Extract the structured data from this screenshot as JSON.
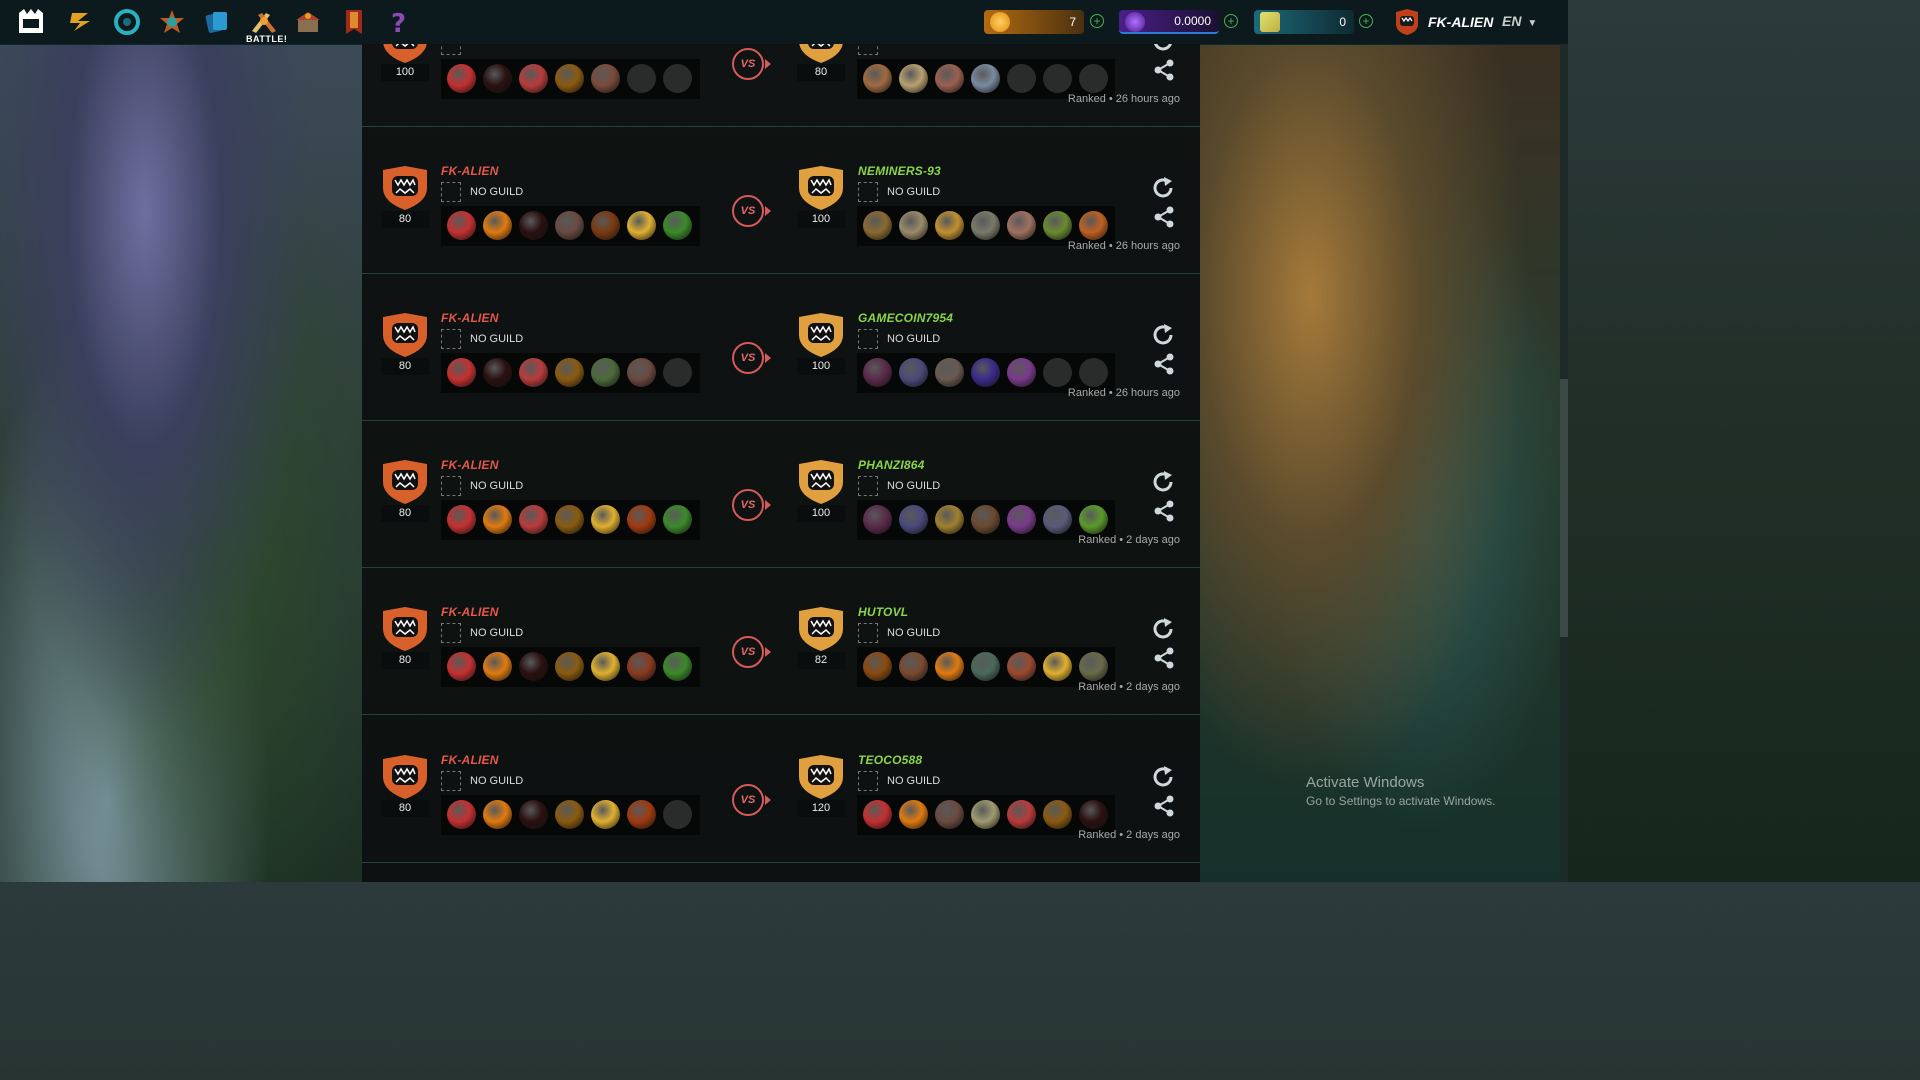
{
  "topnav": {
    "battle_label": "BATTLE!",
    "icons": [
      "logo-icon",
      "quest-icon",
      "portal-icon",
      "leaderboard-icon",
      "cards-icon",
      "battle-icon",
      "shop-icon",
      "guild-icon",
      "help-icon"
    ]
  },
  "currencies": [
    {
      "name": "dec",
      "value": "7"
    },
    {
      "name": "sps",
      "value": "0.0000"
    },
    {
      "name": "credits",
      "value": "0"
    }
  ],
  "user": {
    "name": "FK-ALIEN",
    "language": "EN"
  },
  "windows_notice": {
    "title": "Activate Windows",
    "subtitle": "Go to Settings to activate Windows."
  },
  "colors": {
    "panel": "#0d1010",
    "name_left": "#e5584a",
    "name_right": "#8bd44a",
    "accent": "#d55a5a"
  },
  "battles": [
    {
      "left": {
        "rating": "100",
        "name": "",
        "guild": "",
        "cards": [
          "#c53030",
          "#2a1010",
          "#b83b3b",
          "#8a5a10",
          "#7a4a3a",
          "empty",
          "empty"
        ]
      },
      "right": {
        "rating": "80",
        "name": "",
        "guild": "",
        "cards": [
          "#a06a40",
          "#b8a070",
          "#9a6050",
          "#7a8aa0",
          "empty",
          "empty",
          "empty"
        ]
      },
      "vs": "VS",
      "meta": "Ranked • 26 hours ago"
    },
    {
      "left": {
        "rating": "80",
        "name": "FK-ALIEN",
        "guild": "NO GUILD",
        "cards": [
          "#c53030",
          "#e07a10",
          "#2a1010",
          "#6a4a40",
          "#7a3a10",
          "#e0b030",
          "#3a8a2a"
        ]
      },
      "right": {
        "rating": "100",
        "name": "NEMINERS-93",
        "guild": "NO GUILD",
        "cards": [
          "#8a6a30",
          "#9a8a6a",
          "#c09030",
          "#7a7a6a",
          "#a07060",
          "#6a8a30",
          "#c06020"
        ]
      },
      "vs": "VS",
      "meta": "Ranked • 26 hours ago"
    },
    {
      "left": {
        "rating": "80",
        "name": "FK-ALIEN",
        "guild": "NO GUILD",
        "cards": [
          "#c53030",
          "#2a1010",
          "#b83b3b",
          "#8a5a10",
          "#4a6a3a",
          "#6a4a40",
          "empty"
        ]
      },
      "right": {
        "rating": "100",
        "name": "GAMECOIN7954",
        "guild": "NO GUILD",
        "cards": [
          "#5a2a4a",
          "#4a4a7a",
          "#6a5a50",
          "#3a2a8a",
          "#7a3a8a",
          "empty",
          "empty"
        ]
      },
      "vs": "VS",
      "meta": "Ranked • 26 hours ago"
    },
    {
      "left": {
        "rating": "80",
        "name": "FK-ALIEN",
        "guild": "NO GUILD",
        "cards": [
          "#c53030",
          "#e07a10",
          "#b83b3b",
          "#8a5a10",
          "#e0b030",
          "#a03a10",
          "#3a8a2a"
        ]
      },
      "right": {
        "rating": "100",
        "name": "PHANZI864",
        "guild": "NO GUILD",
        "cards": [
          "#5a2a4a",
          "#4a4a7a",
          "#a08030",
          "#6a4a30",
          "#7a3a8a",
          "#5a5a7a",
          "#5a9a2a"
        ]
      },
      "vs": "VS",
      "meta": "Ranked • 2 days ago"
    },
    {
      "left": {
        "rating": "80",
        "name": "FK-ALIEN",
        "guild": "NO GUILD",
        "cards": [
          "#c53030",
          "#e07a10",
          "#2a1010",
          "#8a5a10",
          "#e0b030",
          "#8a3a20",
          "#3a8a2a"
        ]
      },
      "right": {
        "rating": "82",
        "name": "HUTOVL",
        "guild": "NO GUILD",
        "cards": [
          "#8a4a10",
          "#7a4a30",
          "#e07a10",
          "#4a6a5a",
          "#9a4a30",
          "#e0b030",
          "#6a6a4a"
        ]
      },
      "vs": "VS",
      "meta": "Ranked • 2 days ago"
    },
    {
      "left": {
        "rating": "80",
        "name": "FK-ALIEN",
        "guild": "NO GUILD",
        "cards": [
          "#c53030",
          "#e07a10",
          "#2a1010",
          "#8a5a10",
          "#e0b030",
          "#a03a10",
          "empty"
        ]
      },
      "right": {
        "rating": "120",
        "name": "TEOCO588",
        "guild": "NO GUILD",
        "cards": [
          "#c53030",
          "#e07a10",
          "#6a4a40",
          "#a09a70",
          "#b83b3b",
          "#8a5a10",
          "#2a1010"
        ]
      },
      "vs": "VS",
      "meta": "Ranked • 2 days ago"
    }
  ]
}
